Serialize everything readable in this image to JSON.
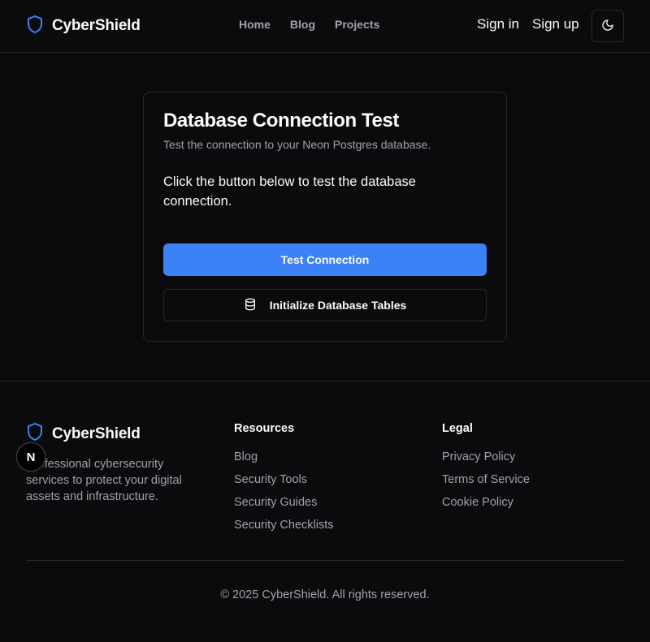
{
  "header": {
    "brand": "CyberShield",
    "nav": [
      "Home",
      "Blog",
      "Projects"
    ],
    "sign_in": "Sign in",
    "sign_up": "Sign up",
    "theme_icon": "moon-icon"
  },
  "card": {
    "title": "Database Connection Test",
    "description": "Test the connection to your Neon Postgres database.",
    "body": "Click the button below to test the database connection.",
    "test_button": "Test Connection",
    "init_button": "Initialize Database Tables",
    "init_icon": "database-icon"
  },
  "footer": {
    "brand": "CyberShield",
    "tagline": "Professional cybersecurity services to protect your digital assets and infrastructure.",
    "resources": {
      "title": "Resources",
      "links": [
        "Blog",
        "Security Tools",
        "Security Guides",
        "Security Checklists"
      ]
    },
    "legal": {
      "title": "Legal",
      "links": [
        "Privacy Policy",
        "Terms of Service",
        "Cookie Policy"
      ]
    },
    "copyright": "© 2025 CyberShield. All rights reserved."
  },
  "badge": {
    "letter": "N"
  },
  "colors": {
    "background": "#0b0b0d",
    "accent": "#3b82f6",
    "border": "#27272a",
    "muted_text": "#a1a1aa"
  }
}
